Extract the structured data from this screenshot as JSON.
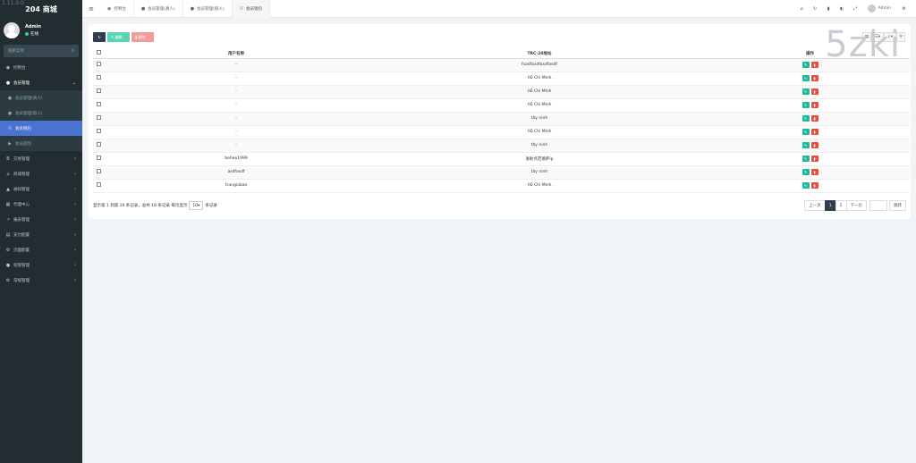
{
  "brand": {
    "title": "204 商城",
    "watermark": "1.11.9.0"
  },
  "user": {
    "name": "Admin",
    "status": "在线"
  },
  "sidebar": {
    "search_placeholder": "搜索菜单",
    "items": [
      {
        "label": "控制台"
      },
      {
        "label": "会员管理"
      },
      {
        "label": "会员管理(真人)"
      },
      {
        "label": "会员管理(假人)"
      },
      {
        "label": "会员钱包"
      },
      {
        "label": "会员提现"
      },
      {
        "label": "交易管理"
      },
      {
        "label": "商城管理"
      },
      {
        "label": "通知管理"
      },
      {
        "label": "代理中心"
      },
      {
        "label": "报表管理"
      },
      {
        "label": "支付配置"
      },
      {
        "label": "页面配置"
      },
      {
        "label": "权限管理"
      },
      {
        "label": "常规管理"
      }
    ]
  },
  "tabs": [
    {
      "label": "控制台"
    },
    {
      "label": "会员管理(真人)"
    },
    {
      "label": "会员管理(假人)"
    },
    {
      "label": "会员钱包"
    }
  ],
  "topbar": {
    "admin": "Admin"
  },
  "toolbar": {
    "edit_label": "编辑",
    "delete_label": "删除"
  },
  "watermark2": "5zki",
  "table": {
    "headers": [
      "用户名称",
      "TRC-20地址",
      "操作"
    ],
    "rows": [
      {
        "user": "-",
        "addr": "fsadfasdfasdfasdf"
      },
      {
        "user": "-",
        "addr": "Hồ Chí Minh"
      },
      {
        "user": "-",
        "addr": "Hồ Chí Minh"
      },
      {
        "user": "-",
        "addr": "Hồ Chí Minh"
      },
      {
        "user": "-",
        "addr": "tây ninh"
      },
      {
        "user": "-",
        "addr": "Hồ Chí Minh"
      },
      {
        "user": "-",
        "addr": "tây ninh"
      },
      {
        "user": "beheo1999",
        "addr": "发射点范德萨ip"
      },
      {
        "user": "asdfasdf",
        "addr": "tây ninh"
      },
      {
        "user": "trangiabao",
        "addr": "Hồ Chí Minh"
      }
    ]
  },
  "footer": {
    "summary": "显示第 1 到第 10 条记录，总共 18 条记录 每页显示",
    "page_size": "10",
    "suffix": "条记录"
  },
  "pager": {
    "prev": "上一页",
    "p1": "1",
    "p2": "2",
    "next": "下一页",
    "go": "跳转"
  }
}
